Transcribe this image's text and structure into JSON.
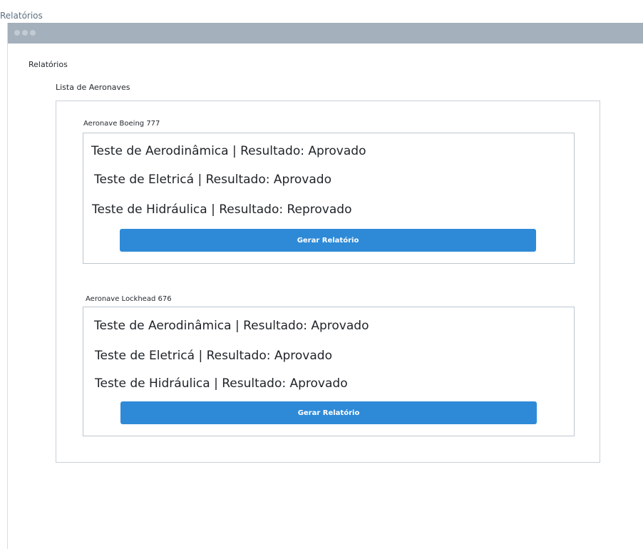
{
  "window": {
    "title": "Relatórios"
  },
  "page": {
    "heading": "Relatórios",
    "list_title": "Lista de Aeronaves"
  },
  "aircraft": [
    {
      "name": "Aeronave Boeing 777",
      "tests": [
        "Teste de Aerodinâmica | Resultado: Aprovado",
        "Teste de Eletricá | Resultado: Aprovado",
        "Teste de Hidráulica | Resultado: Reprovado"
      ],
      "button_label": "Gerar Relatório"
    },
    {
      "name": "Aeronave Lockhead 676",
      "tests": [
        "Teste de Aerodinâmica | Resultado: Aprovado",
        "Teste de Eletricá | Resultado: Aprovado",
        "Teste de Hidráulica | Resultado: Aprovado"
      ],
      "button_label": "Gerar Relatório"
    }
  ],
  "colors": {
    "button": "#2e8ad7",
    "title_bar": "#a4b0bb",
    "border": "#c7d0d8"
  }
}
